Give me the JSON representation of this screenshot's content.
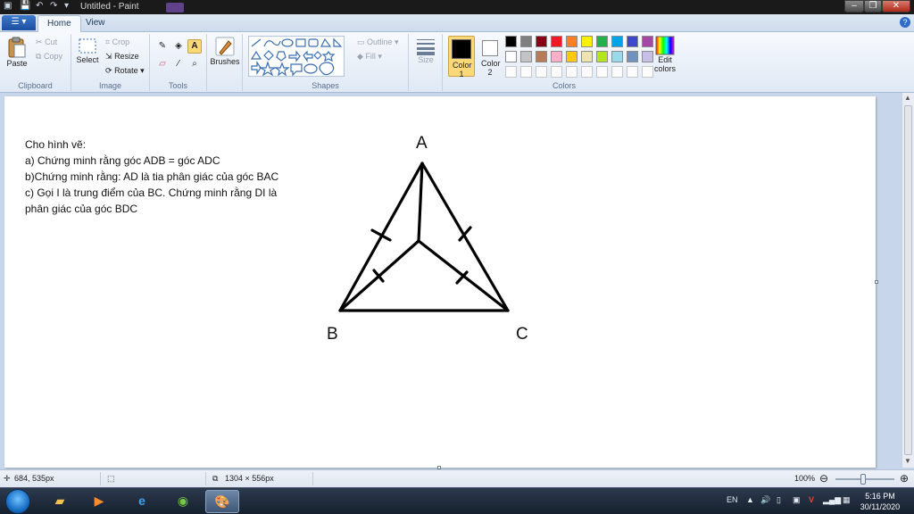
{
  "window": {
    "title": "Untitled - Paint",
    "controls": {
      "minimize": "–",
      "maximize": "❐",
      "close": "✕"
    }
  },
  "tabs": {
    "file_menu": "☰ ▾",
    "home": "Home",
    "view": "View",
    "help": "?"
  },
  "ribbon": {
    "clipboard": {
      "label": "Clipboard",
      "paste": "Paste",
      "cut": "Cut",
      "copy": "Copy"
    },
    "image": {
      "label": "Image",
      "select": "Select",
      "crop": "Crop",
      "resize": "Resize",
      "rotate": "Rotate ▾"
    },
    "tools": {
      "label": "Tools"
    },
    "brushes": {
      "label": "Brushes"
    },
    "shapes": {
      "label": "Shapes",
      "outline": "Outline ▾",
      "fill": "Fill ▾"
    },
    "size": {
      "label": "Size"
    },
    "colors": {
      "label": "Colors",
      "color1": "Color 1",
      "color2": "Color 2",
      "edit": "Edit colors",
      "color1_value": "#000000",
      "color2_value": "#ffffff",
      "palette_row1": [
        "#000000",
        "#7f7f7f",
        "#880015",
        "#ed1c24",
        "#ff7f27",
        "#fff200",
        "#22b14c",
        "#00a2e8",
        "#3f48cc",
        "#a349a4"
      ],
      "palette_row2": [
        "#ffffff",
        "#c3c3c3",
        "#b97a57",
        "#ffaec9",
        "#ffc90e",
        "#efe4b0",
        "#b5e61d",
        "#99d9ea",
        "#7092be",
        "#c8bfe7"
      ]
    }
  },
  "canvas": {
    "text_lines": [
      "Cho hình vẽ:",
      "a) Chứng minh rằng góc ADB = góc ADC",
      "b)Chứng minh rằng: AD là tia phân giác của góc BAC",
      "c) Gọi I là trung điểm của BC. Chứng minh rằng DI là",
      "phân giác của góc BDC"
    ],
    "vertex_labels": {
      "A": "A",
      "B": "B",
      "C": "C"
    }
  },
  "status": {
    "cursor_pos": "684, 535px",
    "canvas_size": "1304 × 556px",
    "zoom": "100%"
  },
  "taskbar": {
    "language": "EN",
    "time": "5:16 PM",
    "date": "30/11/2020"
  }
}
